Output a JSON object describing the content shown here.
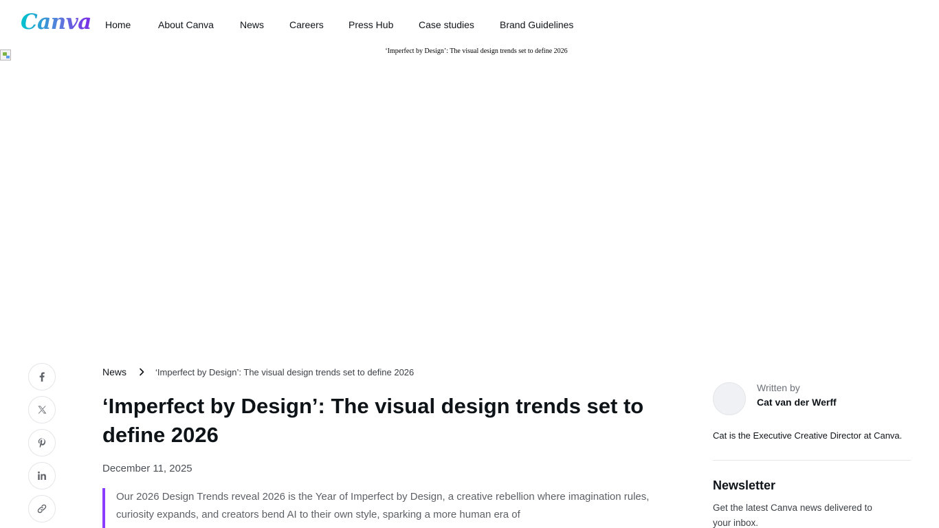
{
  "header": {
    "logo_text": "Canva",
    "nav": [
      {
        "label": "Home"
      },
      {
        "label": "About Canva"
      },
      {
        "label": "News"
      },
      {
        "label": "Careers"
      },
      {
        "label": "Press Hub"
      },
      {
        "label": "Case studies"
      },
      {
        "label": "Brand Guidelines"
      }
    ]
  },
  "hero": {
    "alt_text": "‘Imperfect by Design’: The visual design trends set to define 2026"
  },
  "share": {
    "icons": [
      "facebook-icon",
      "x-icon",
      "pinterest-icon",
      "linkedin-icon",
      "link-icon"
    ]
  },
  "article": {
    "breadcrumb": {
      "root": "News",
      "current": "‘Imperfect by Design’: The visual design trends set to define 2026"
    },
    "title": "‘Imperfect by Design’: The visual design trends set to define 2026",
    "date": "December 11, 2025",
    "lede": "Our 2026 Design Trends reveal 2026 is the Year of Imperfect by Design, a creative rebellion where imagination rules, curiosity expands, and creators bend AI to their own style, sparking a more human era of"
  },
  "sidebar": {
    "written_by_label": "Written by",
    "author_name": "Cat van der Werff",
    "author_bio": "Cat is the Executive Creative Director at Canva.",
    "newsletter_title": "Newsletter",
    "newsletter_text": "Get the latest Canva news delivered to your inbox."
  },
  "colors": {
    "accent_purple": "#8b3dff",
    "text_primary": "#0e1318",
    "logo_gradient_start": "#00c4cc",
    "logo_gradient_end": "#7d2ae8"
  }
}
